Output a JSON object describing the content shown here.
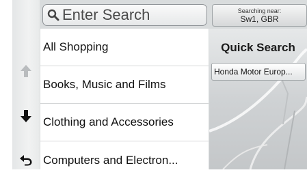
{
  "search": {
    "placeholder": "Enter Search"
  },
  "location": {
    "caption": "Searching near:",
    "value": "Sw1, GBR"
  },
  "categories": [
    {
      "label": "All Shopping"
    },
    {
      "label": "Books, Music and Films"
    },
    {
      "label": "Clothing and Accessories"
    },
    {
      "label": "Computers and Electron..."
    }
  ],
  "quick_search": {
    "title": "Quick Search",
    "item": "Honda Motor Europ..."
  },
  "controls": {
    "icons": [
      "arrow-up-icon",
      "arrow-down-icon",
      "back-icon"
    ]
  },
  "colors": {
    "screen_bg": "#d9dcdd",
    "list_bg": "#ffffff",
    "divider": "#d4d6d7"
  }
}
